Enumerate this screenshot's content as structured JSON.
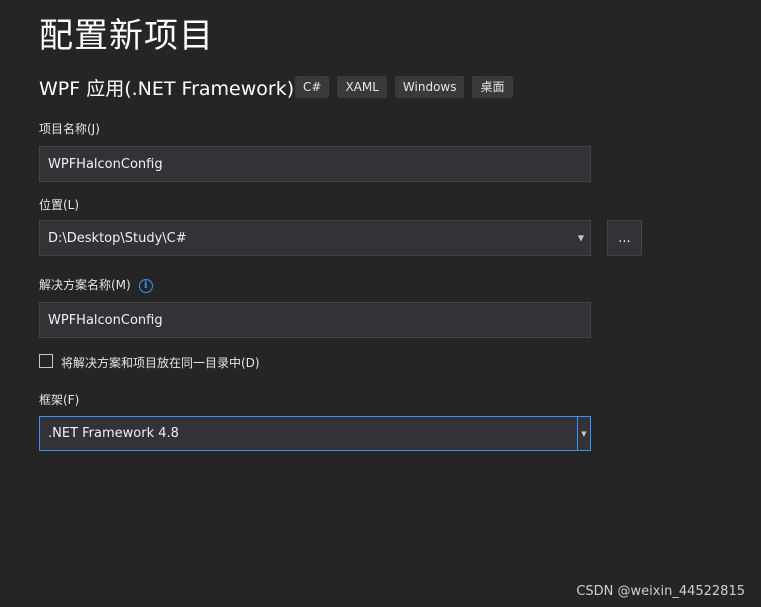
{
  "page": {
    "title": "配置新项目",
    "template_name": "WPF 应用(.NET Framework)",
    "tags": [
      "C#",
      "XAML",
      "Windows",
      "桌面"
    ]
  },
  "project_name": {
    "label": "项目名称(J)",
    "value": "WPFHalconConfig"
  },
  "location": {
    "label": "位置(L)",
    "value": "D:\\Desktop\\Study\\C#",
    "browse_label": "..."
  },
  "solution_name": {
    "label": "解决方案名称(M)",
    "info_glyph": "i",
    "value": "WPFHalconConfig"
  },
  "same_directory": {
    "label": "将解决方案和项目放在同一目录中(D)",
    "checked": false
  },
  "framework": {
    "label": "框架(F)",
    "value": ".NET Framework 4.8"
  },
  "watermark": "CSDN @weixin_44522815",
  "colors": {
    "background": "#252526",
    "field": "#333337",
    "accent": "#3794ff"
  }
}
